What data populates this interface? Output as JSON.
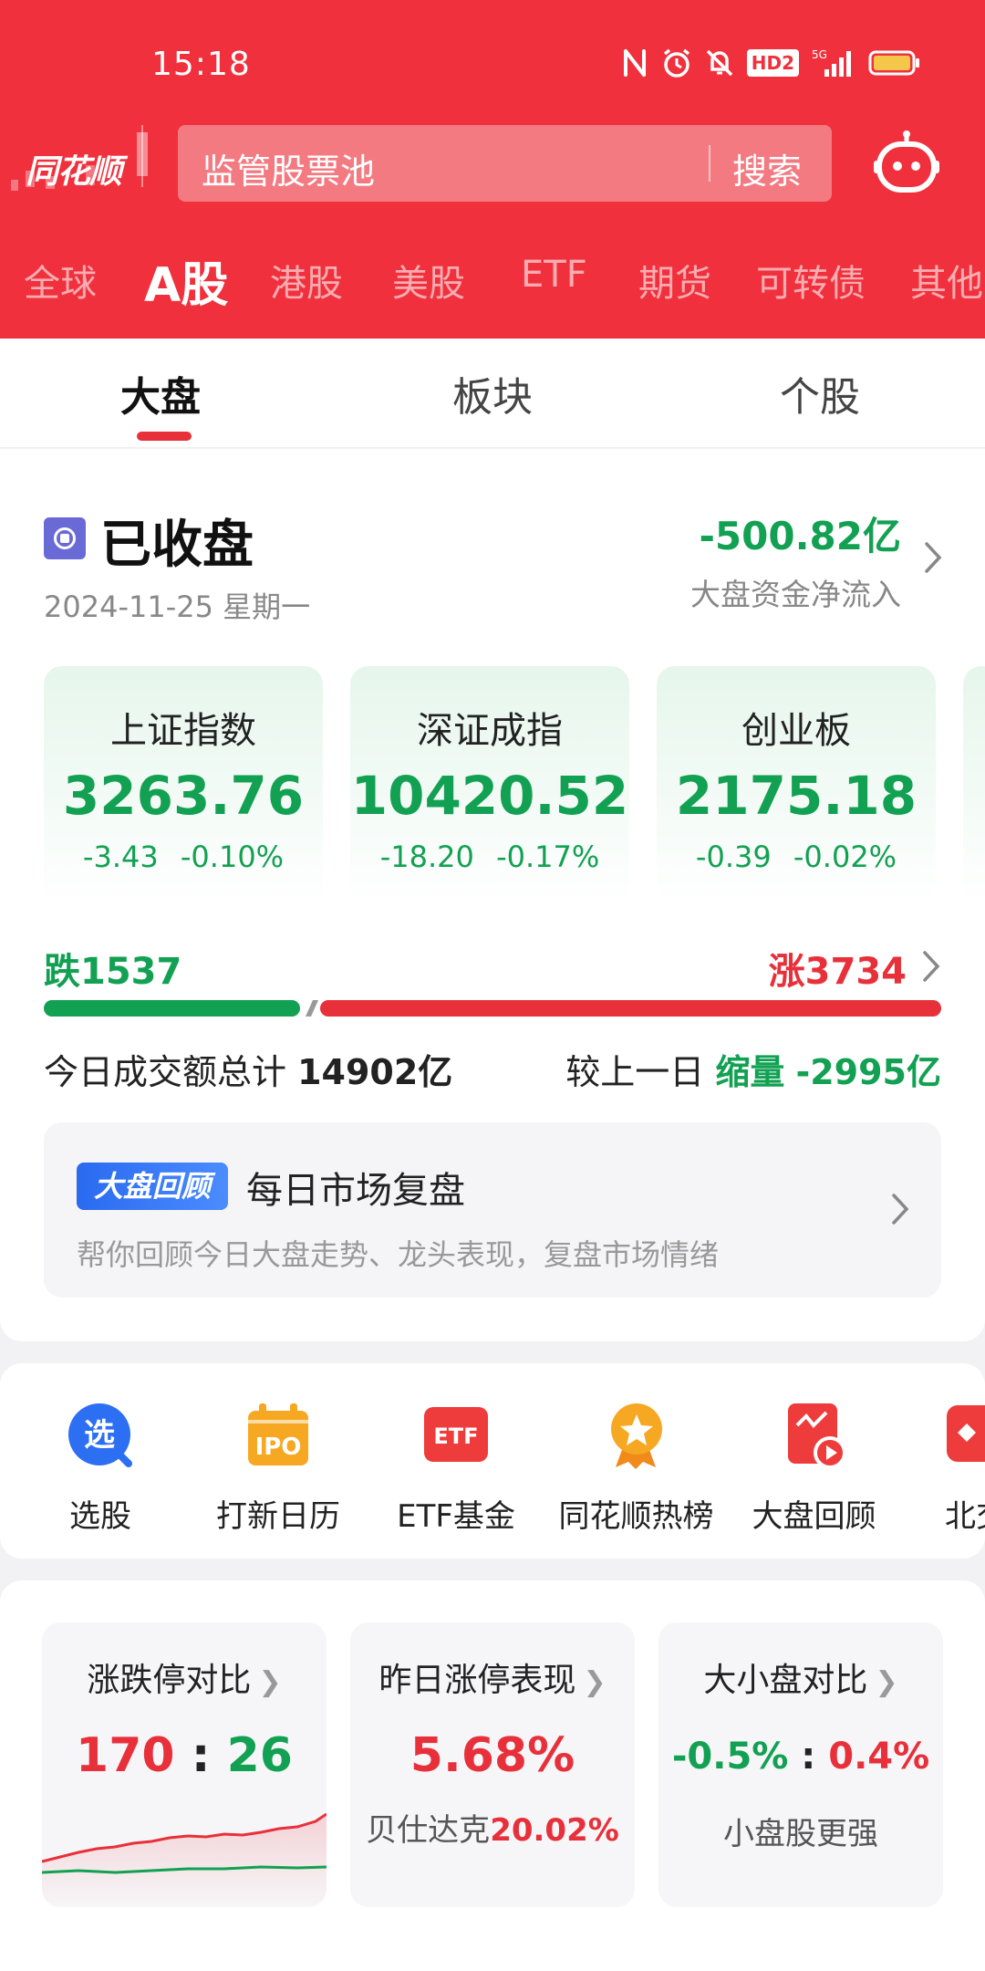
{
  "status_bar": {
    "time": "15:18",
    "hd_badge": "HD2",
    "network": "5G"
  },
  "header": {
    "logo": "同花顺",
    "search_placeholder": "监管股票池",
    "search_button": "搜索",
    "market_tabs": [
      "全球",
      "A股",
      "港股",
      "美股",
      "ETF",
      "期货",
      "可转债",
      "其他"
    ],
    "active_market_tab": "A股"
  },
  "sub_tabs": [
    "大盘",
    "板块",
    "个股"
  ],
  "market": {
    "status": "已收盘",
    "date": "2024-11-25 星期一",
    "net_flow_value": "-500.82亿",
    "net_flow_label": "大盘资金净流入",
    "indices": [
      {
        "name": "上证指数",
        "value": "3263.76",
        "change": "-3.43",
        "pct": "-0.10%"
      },
      {
        "name": "深证成指",
        "value": "10420.52",
        "change": "-18.20",
        "pct": "-0.17%"
      },
      {
        "name": "创业板",
        "value": "2175.18",
        "change": "-0.39",
        "pct": "-0.02%"
      }
    ],
    "fall_label": "跌1537",
    "rise_label": "涨3734",
    "fall_count": 1537,
    "rise_count": 3734,
    "turnover_label": "今日成交额总计",
    "turnover_value": "14902亿",
    "compare_label": "较上一日",
    "compare_state": "缩量",
    "compare_value": "-2995亿"
  },
  "review": {
    "badge": "大盘回顾",
    "title": "每日市场复盘",
    "subtitle": "帮你回顾今日大盘走势、龙头表现，复盘市场情绪"
  },
  "shortcuts": [
    {
      "label": "选股",
      "icon": "stock-picker-icon"
    },
    {
      "label": "打新日历",
      "icon": "ipo-calendar-icon"
    },
    {
      "label": "ETF基金",
      "icon": "etf-icon"
    },
    {
      "label": "同花顺热榜",
      "icon": "hot-list-medal-icon"
    },
    {
      "label": "大盘回顾",
      "icon": "market-review-play-icon"
    },
    {
      "label": "北交",
      "icon": "beijing-exchange-icon"
    }
  ],
  "stats": {
    "limit_compare": {
      "title": "涨跌停对比",
      "up": "170",
      "sep": ":",
      "down": "26"
    },
    "yesterday_limit": {
      "title": "昨日涨停表现",
      "value": "5.68%",
      "sub_label": "贝仕达克",
      "sub_value": "20.02%"
    },
    "cap_compare": {
      "title": "大小盘对比",
      "left": "-0.5%",
      "sep": ":",
      "right": "0.4%",
      "sub": "小盘股更强"
    }
  },
  "colors": {
    "header_red": "#f0303c",
    "rise_red": "#e8303a",
    "fall_green": "#12a152",
    "badge_blue": "#2a6af0"
  }
}
